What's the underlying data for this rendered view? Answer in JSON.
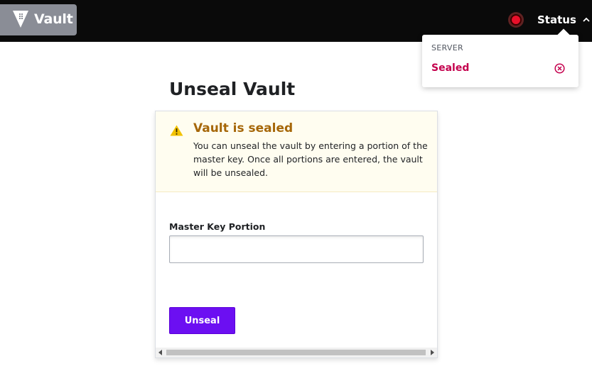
{
  "header": {
    "logo_text": "Vault",
    "status_label": "Status",
    "status_color": "#e8102a"
  },
  "status_popover": {
    "heading": "SERVER",
    "server_status": "Sealed",
    "status_color": "#c4004d"
  },
  "main": {
    "title": "Unseal Vault",
    "alert": {
      "title": "Vault is sealed",
      "body": "You can unseal the vault by entering a portion of the master key. Once all portions are entered, the vault will be unsealed."
    },
    "form": {
      "field_label": "Master Key Portion",
      "field_value": "",
      "submit_label": "Unseal"
    }
  },
  "colors": {
    "accent": "#6c0ff2",
    "warning": "#a66709",
    "topbar": "#0a0a0a"
  },
  "icons": {
    "logo": "vault-logo-icon",
    "status": "status-dot-icon",
    "chevron": "chevron-up-icon",
    "sealed": "x-circle-icon",
    "alert": "warning-triangle-icon"
  }
}
